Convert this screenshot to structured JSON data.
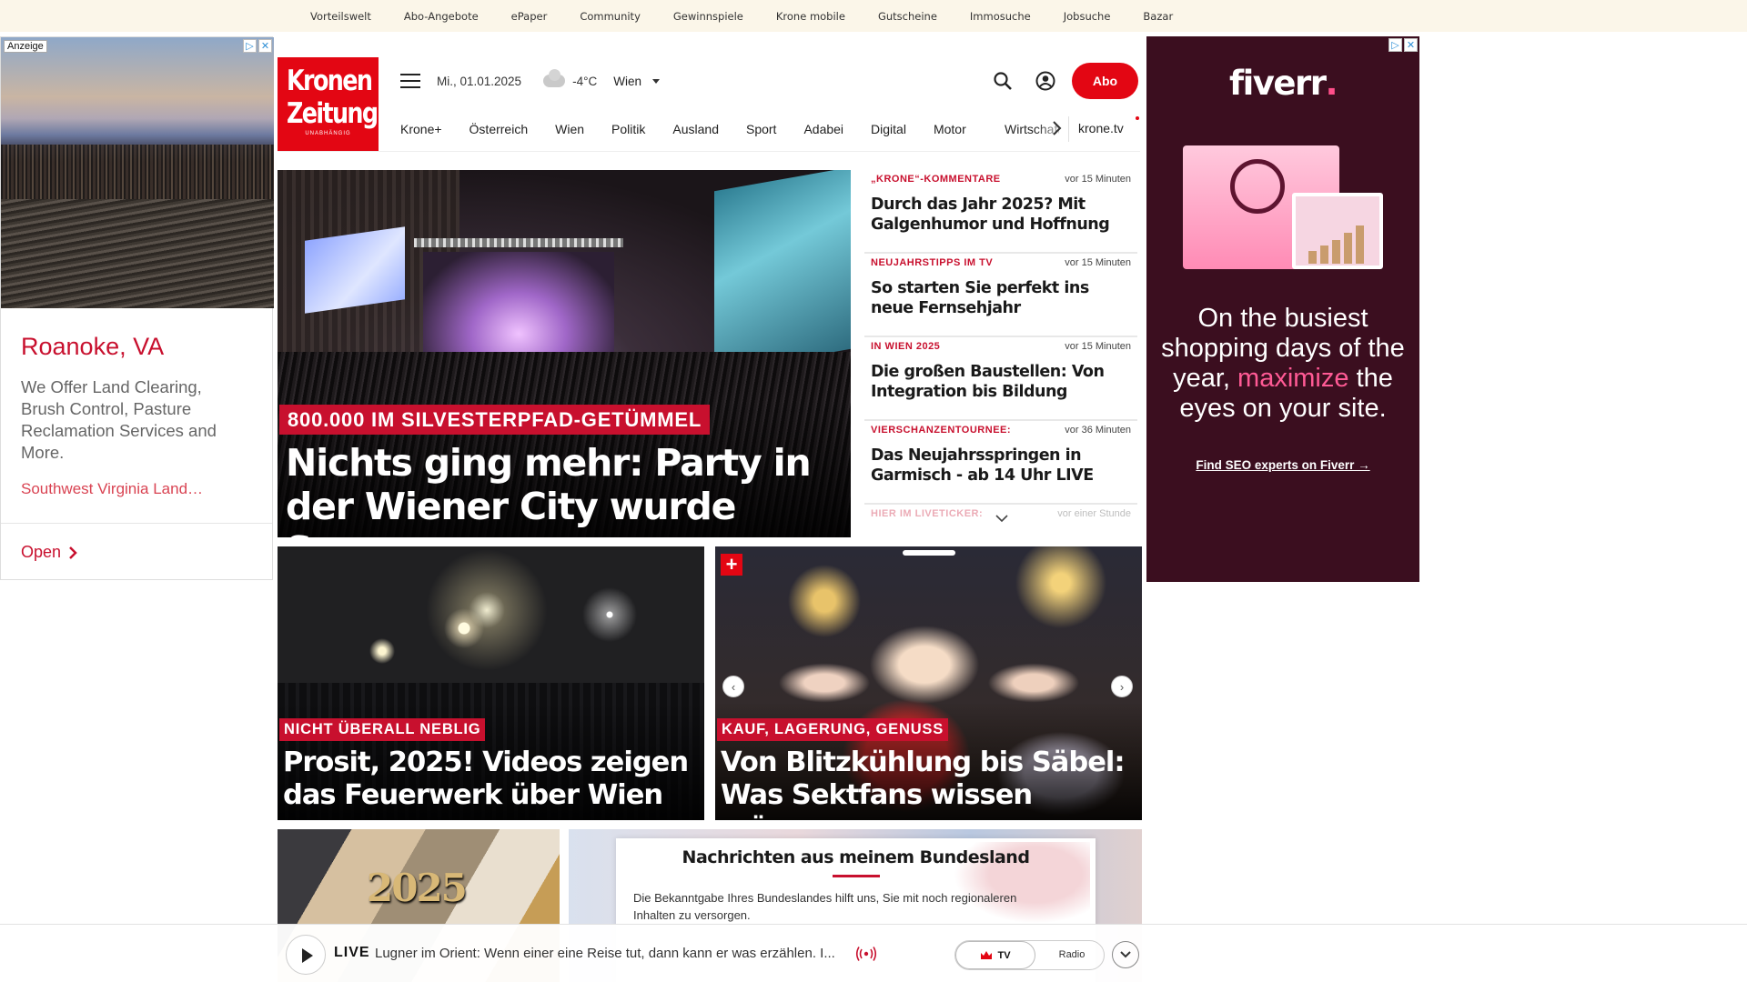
{
  "service_nav": [
    "Vorteilswelt",
    "Abo-Angebote",
    "ePaper",
    "Community",
    "Gewinnspiele",
    "Krone mobile",
    "Gutscheine",
    "Immosuche",
    "Jobsuche",
    "Bazar"
  ],
  "left_ad": {
    "label": "Anzeige",
    "title": "Roanoke, VA",
    "body": "We Offer Land Clearing, Brush Control, Pasture Reclamation Services and More.",
    "link": "Southwest Virginia Land…",
    "open": "Open"
  },
  "header": {
    "logo_line1": "Kronen",
    "logo_line2": "Zeitung",
    "logo_line3": "UNABHÄNGIG",
    "date": "Mi., 01.01.2025",
    "temperature": "-4°C",
    "city": "Wien",
    "abo_label": "Abo",
    "nav_items": [
      "Krone+",
      "Österreich",
      "Wien",
      "Politik",
      "Ausland",
      "Sport",
      "Adabei",
      "Digital",
      "Motor"
    ],
    "nav_truncated": "Wirtschaft",
    "nav_tv": "krone.tv"
  },
  "hero": {
    "kicker": "800.000 IM SILVESTERPFAD-GETÜMMEL",
    "headline": "Nichts ging mehr: Party in der Wiener City wurde Sperrzone"
  },
  "ticker": [
    {
      "category": "„KRONE“-KOMMENTARE",
      "time": "vor 15 Minuten",
      "title": "Durch das Jahr 2025? Mit Galgenhumor und Hoffnung"
    },
    {
      "category": "NEUJAHRSTIPPS IM TV",
      "time": "vor 15 Minuten",
      "title": "So starten Sie perfekt ins neue Fernsehjahr"
    },
    {
      "category": "IN WIEN 2025",
      "time": "vor 15 Minuten",
      "title": "Die großen Baustellen: Von Integration bis Bildung"
    },
    {
      "category": "VIERSCHANZENTOURNEE:",
      "time": "vor 36 Minuten",
      "title": "Das Neujahrsspringen in Garmisch - ab 14 Uhr LIVE"
    },
    {
      "category": "HIER IM LIVETICKER:",
      "time": "vor einer Stunde",
      "title": ""
    }
  ],
  "cards": [
    {
      "kicker": "NICHT ÜBERALL NEBLIG",
      "title": "Prosit, 2025! Videos zeigen das Feuerwerk über Wien"
    },
    {
      "kicker": "KAUF, LAGERUNG, GENUSS",
      "title": "Von Blitzkühlung bis Säbel: Was Sektfans wissen müssen"
    }
  ],
  "card3_year": "2025",
  "bundesland_popup": {
    "heading": "Nachrichten aus meinem Bundesland",
    "text": "Die Bekanntgabe Ihres Bundeslandes hilft uns, Sie mit noch regionaleren Inhalten zu versorgen."
  },
  "live_bar": {
    "label": "LIVE",
    "text": "Lugner im Orient: Wenn einer eine Reise tut, dann kann er was erzählen. I...",
    "tv": "TV",
    "radio": "Radio"
  },
  "right_ad": {
    "brand": "fiverr",
    "brand_dot": ".",
    "pitch_part1": "On the busiest shopping days of the year,",
    "pitch_highlight": "maximize",
    "pitch_part2": "the eyes on your site.",
    "cta": "Find SEO experts on Fiverr →"
  },
  "colors": {
    "brand_red": "#e30613",
    "kicker_red": "#c8102e",
    "service_bar_bg": "#fbf6e9",
    "fiverr_bg": "#3b0e1f",
    "fiverr_pink": "#ff5a95"
  }
}
